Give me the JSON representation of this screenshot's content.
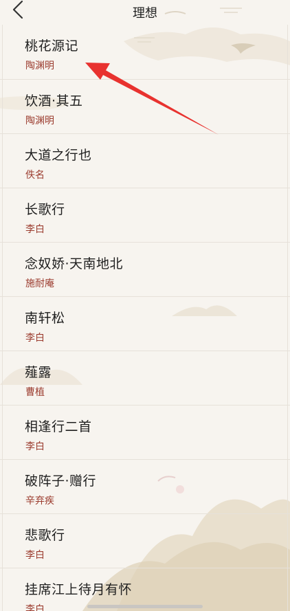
{
  "header": {
    "title": "理想"
  },
  "poems": [
    {
      "title": "桃花源记",
      "author": "陶渊明"
    },
    {
      "title": "饮酒·其五",
      "author": "陶渊明"
    },
    {
      "title": "大道之行也",
      "author": "佚名"
    },
    {
      "title": "长歌行",
      "author": "李白"
    },
    {
      "title": "念奴娇·天南地北",
      "author": "施耐庵"
    },
    {
      "title": "南轩松",
      "author": "李白"
    },
    {
      "title": "薤露",
      "author": "曹植"
    },
    {
      "title": "相逢行二首",
      "author": "李白"
    },
    {
      "title": "破阵子·赠行",
      "author": "辛弃疾"
    },
    {
      "title": "悲歌行",
      "author": "李白"
    },
    {
      "title": "挂席江上待月有怀",
      "author": "李白"
    }
  ],
  "colors": {
    "background": "#f7f4ef",
    "author_text": "#9b3b2e",
    "arrow": "#e8322f"
  },
  "icons": {
    "back": "chevron-left-icon",
    "annotation": "red-arrow-annotation"
  }
}
